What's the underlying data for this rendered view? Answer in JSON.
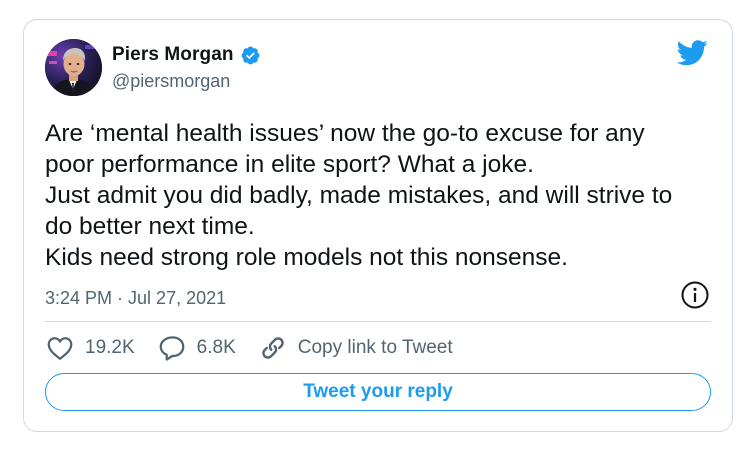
{
  "tweet": {
    "author": {
      "display_name": "Piers Morgan",
      "handle": "@piersmorgan",
      "verified": true,
      "avatar_icon": "avatar-photo"
    },
    "text_lines": [
      "Are ‘mental health issues’ now the go-to excuse for any",
      "poor performance in elite sport? What a joke.",
      "Just admit you did badly, made mistakes, and will strive to",
      "do better next time.",
      "Kids need strong role models not this nonsense."
    ],
    "time": "3:24 PM",
    "separator": "·",
    "date": "Jul 27, 2021",
    "actions": {
      "likes": "19.2K",
      "replies": "6.8K",
      "copy_link_label": "Copy link to Tweet"
    },
    "reply_button_label": "Tweet your reply"
  },
  "icons": {
    "brand": "twitter-bird-icon",
    "verified": "verified-badge-icon",
    "info": "info-icon",
    "like": "heart-icon",
    "reply": "speech-bubble-icon",
    "link": "link-icon"
  },
  "colors": {
    "accent": "#1d9bf0",
    "text": "#0f1419",
    "secondary_text": "#536471",
    "border": "#cfd9de"
  }
}
